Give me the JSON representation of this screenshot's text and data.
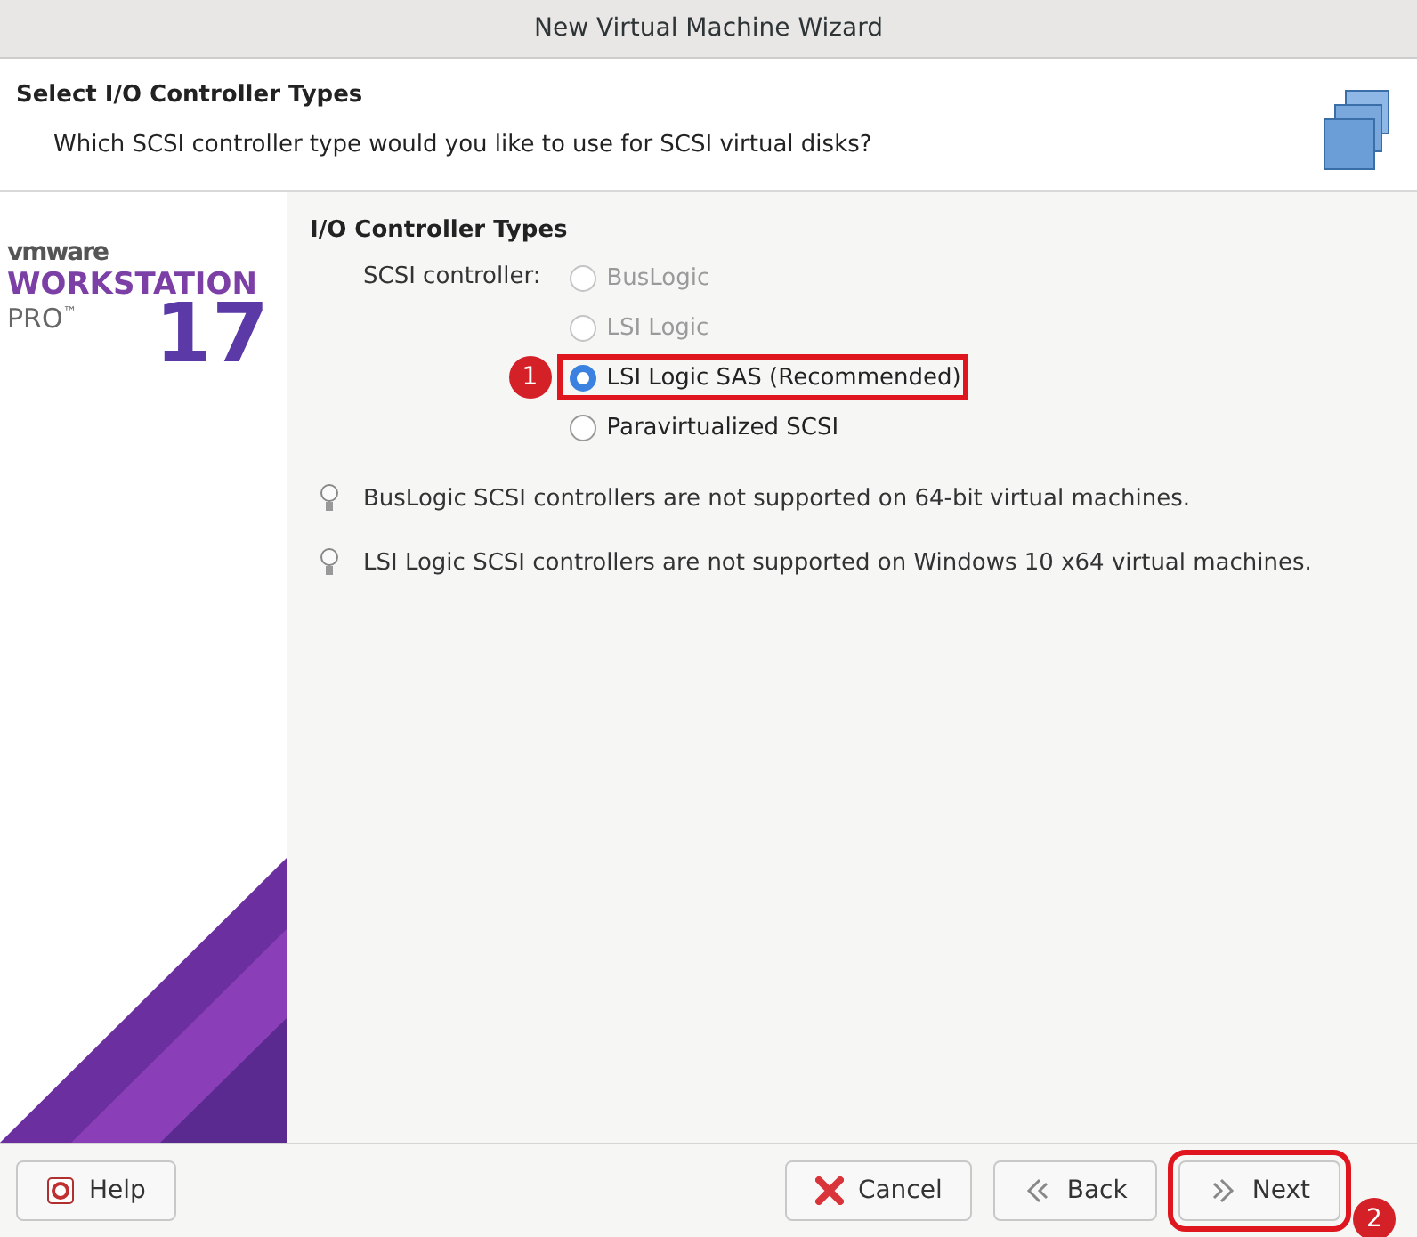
{
  "window": {
    "title": "New Virtual Machine Wizard"
  },
  "header": {
    "title": "Select I/O Controller Types",
    "subtitle": "Which SCSI controller type would you like to use for SCSI virtual disks?"
  },
  "brand": {
    "vendor": "vmware",
    "product": "WORKSTATION",
    "edition": "PRO$^{™}$",
    "version": "17"
  },
  "group": {
    "title": "I/O Controller Types",
    "label": "SCSI controller:",
    "options": [
      {
        "label": "BusLogic",
        "selected": false,
        "disabled": true
      },
      {
        "label": "LSI Logic",
        "selected": false,
        "disabled": true
      },
      {
        "label": "LSI Logic SAS (Recommended)",
        "selected": true,
        "disabled": false,
        "highlighted": true,
        "badge": "1"
      },
      {
        "label": "Paravirtualized SCSI",
        "selected": false,
        "disabled": false
      }
    ]
  },
  "notes": [
    "BusLogic SCSI controllers are not supported on 64-bit virtual machines.",
    "LSI Logic SCSI controllers are not supported on Windows 10 x64 virtual machines."
  ],
  "buttons": [
    {
      "kind": "help",
      "label": "Help"
    },
    {
      "kind": "cancel",
      "label": "Cancel"
    },
    {
      "kind": "back",
      "label": "Back"
    },
    {
      "kind": "next",
      "label": "Next",
      "highlighted": true,
      "badge": "2"
    }
  ]
}
